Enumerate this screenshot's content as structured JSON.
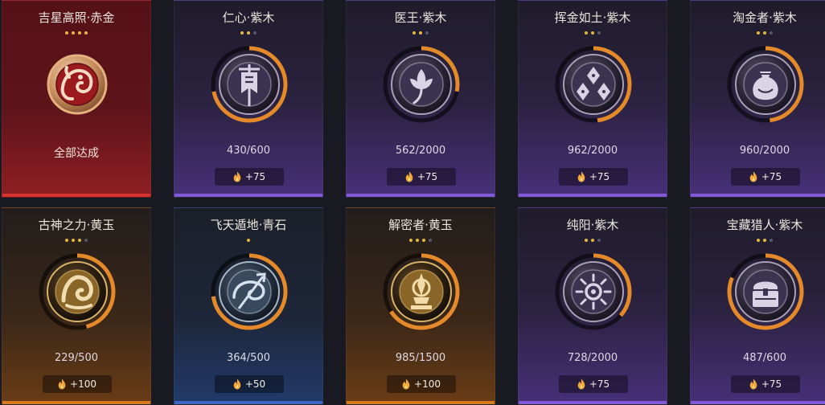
{
  "achievements": [
    {
      "title": "吉星高照·赤金",
      "tier": "red",
      "stars": 4,
      "max_stars": 4,
      "completed": true,
      "status_text": "全部达成",
      "icon": "koi-fish-icon"
    },
    {
      "title": "仁心·紫木",
      "tier": "purple",
      "stars": 2,
      "max_stars": 3,
      "progress": "430/600",
      "progress_fraction": 0.717,
      "reward": "+75",
      "icon": "banner-icon"
    },
    {
      "title": "医王·紫木",
      "tier": "purple",
      "stars": 2,
      "max_stars": 3,
      "progress": "562/2000",
      "progress_fraction": 0.281,
      "reward": "+75",
      "icon": "lotus-icon"
    },
    {
      "title": "挥金如土·紫木",
      "tier": "purple",
      "stars": 2,
      "max_stars": 3,
      "progress": "962/2000",
      "progress_fraction": 0.481,
      "reward": "+75",
      "icon": "gold-coins-icon"
    },
    {
      "title": "淘金者·紫木",
      "tier": "purple",
      "stars": 2,
      "max_stars": 3,
      "progress": "960/2000",
      "progress_fraction": 0.48,
      "reward": "+75",
      "icon": "treasure-pouch-icon"
    },
    {
      "title": "古神之力·黄玉",
      "tier": "gold",
      "stars": 3,
      "max_stars": 4,
      "progress": "229/500",
      "progress_fraction": 0.458,
      "reward": "+100",
      "icon": "ancient-god-icon"
    },
    {
      "title": "飞天遁地·青石",
      "tier": "blue",
      "stars": 1,
      "max_stars": 1,
      "progress": "364/500",
      "progress_fraction": 0.728,
      "reward": "+50",
      "icon": "trident-swirl-icon"
    },
    {
      "title": "解密者·黄玉",
      "tier": "gold",
      "stars": 3,
      "max_stars": 4,
      "progress": "985/1500",
      "progress_fraction": 0.657,
      "reward": "+100",
      "icon": "relic-altar-icon"
    },
    {
      "title": "纯阳·紫木",
      "tier": "purple",
      "stars": 2,
      "max_stars": 3,
      "progress": "728/2000",
      "progress_fraction": 0.364,
      "reward": "+75",
      "icon": "sun-icon"
    },
    {
      "title": "宝藏猎人·紫木",
      "tier": "purple",
      "stars": 2,
      "max_stars": 3,
      "progress": "487/600",
      "progress_fraction": 0.812,
      "reward": "+75",
      "icon": "treasure-chest-icon"
    }
  ],
  "colors": {
    "progress_arc": "#e58a2a",
    "star_on": "#e6b73c",
    "star_off": "#59566a",
    "tier_red": "#d8322c",
    "tier_purple": "#8058d8",
    "tier_gold": "#d87a1e",
    "tier_blue": "#3e66c4"
  }
}
